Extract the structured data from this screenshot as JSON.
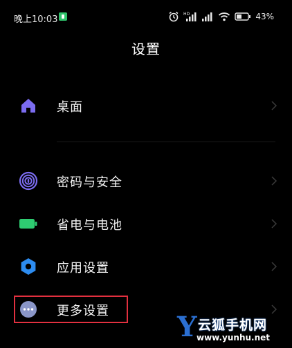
{
  "status_bar": {
    "time": "晚上10:03",
    "battery_percent": "43%"
  },
  "header": {
    "title": "设置"
  },
  "settings": {
    "items": [
      {
        "label": "桌面",
        "icon": "home-icon",
        "color": "#7b6cf0"
      },
      {
        "label": "密码与安全",
        "icon": "fingerprint-icon",
        "color": "#7b6cf0"
      },
      {
        "label": "省电与电池",
        "icon": "battery-icon",
        "color": "#2ecc71"
      },
      {
        "label": "应用设置",
        "icon": "gear-icon",
        "color": "#2d8cf0"
      },
      {
        "label": "更多设置",
        "icon": "more-icon",
        "color": "#8a96c8"
      }
    ]
  },
  "highlight": {
    "color": "#e2303f"
  },
  "watermark": {
    "logo_letter": "Y",
    "site_name": "云狐手机网",
    "url": "www.yunhu.net"
  }
}
